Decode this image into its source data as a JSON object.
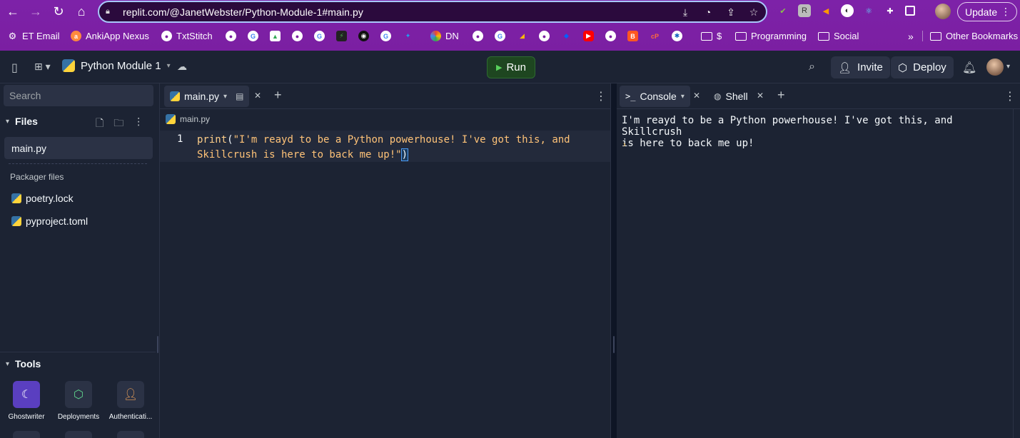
{
  "browser": {
    "url": "replit.com/@JanetWebster/Python-Module-1#main.py",
    "update_label": "Update",
    "bookmarks": [
      {
        "label": "ET Email"
      },
      {
        "label": "AnkiApp Nexus"
      },
      {
        "label": "TxtStitch"
      },
      {
        "label": "DN"
      },
      {
        "label": "$"
      },
      {
        "label": "Programming"
      },
      {
        "label": "Social"
      },
      {
        "label": "Other Bookmarks"
      }
    ],
    "overflow_label": "»"
  },
  "header": {
    "repl_title": "Python Module 1",
    "run_label": "Run",
    "invite_label": "Invite",
    "deploy_label": "Deploy"
  },
  "sidebar": {
    "search_placeholder": "Search",
    "files_heading": "Files",
    "files": [
      {
        "name": "main.py",
        "active": true
      }
    ],
    "packager_label": "Packager files",
    "packager_files": [
      {
        "name": "poetry.lock"
      },
      {
        "name": "pyproject.toml"
      }
    ],
    "tools_heading": "Tools",
    "tools": [
      {
        "label": "Ghostwriter"
      },
      {
        "label": "Deployments"
      },
      {
        "label": "Authenticati..."
      }
    ]
  },
  "editor": {
    "tab_label": "main.py",
    "breadcrumb": "main.py",
    "line_number": "1",
    "code_fn": "print",
    "code_open": "(",
    "code_string_line1": "\"I'm reayd to be a Python powerhouse! I've got this, and",
    "code_string_line2": "Skillcrush is here to back me up!\"",
    "code_close": ")"
  },
  "console": {
    "console_tab": "Console",
    "shell_tab": "Shell",
    "output": "I'm reayd to be a Python powerhouse! I've got this, and Skillcrush\nis here to back me up!",
    "prompt": "›"
  },
  "colors": {
    "browser_accent": "#7b1fa2",
    "app_bg": "#1c2333",
    "surface": "#2b3245",
    "run_green": "#1e4620",
    "string_orange": "#ffc378"
  }
}
